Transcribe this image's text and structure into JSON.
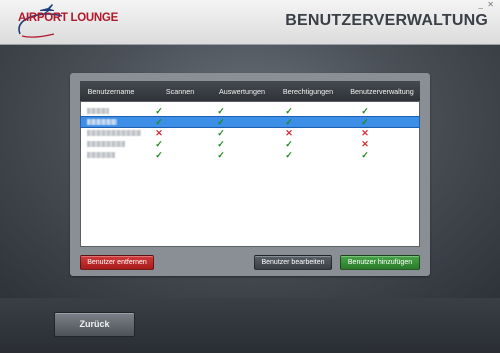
{
  "app": {
    "logo_text": "AIRPORT LOUNGE",
    "page_title": "BENUTZERVERWALTUNG"
  },
  "window": {
    "minimize": "_",
    "close": "✕"
  },
  "table": {
    "columns": [
      "Benutzername",
      "Scannen",
      "Auswertungen",
      "Berechtigungen",
      "Benutzerverwaltung"
    ],
    "rows": [
      {
        "selected": false,
        "perms": [
          true,
          true,
          true,
          true
        ]
      },
      {
        "selected": true,
        "perms": [
          true,
          true,
          true,
          true
        ]
      },
      {
        "selected": false,
        "perms": [
          false,
          true,
          false,
          false
        ]
      },
      {
        "selected": false,
        "perms": [
          true,
          true,
          true,
          false
        ]
      },
      {
        "selected": false,
        "perms": [
          true,
          true,
          true,
          true
        ]
      }
    ],
    "yes_symbol": "✓",
    "no_symbol": "✕"
  },
  "buttons": {
    "remove": "Benutzer entfernen",
    "edit": "Benutzer bearbeiten",
    "add": "Benutzer hinzufügen",
    "back": "Zurück"
  },
  "colors": {
    "brand": "#b0192b",
    "selection": "#3d8ee6",
    "yes": "#1f8a1f",
    "no": "#d0303a"
  }
}
